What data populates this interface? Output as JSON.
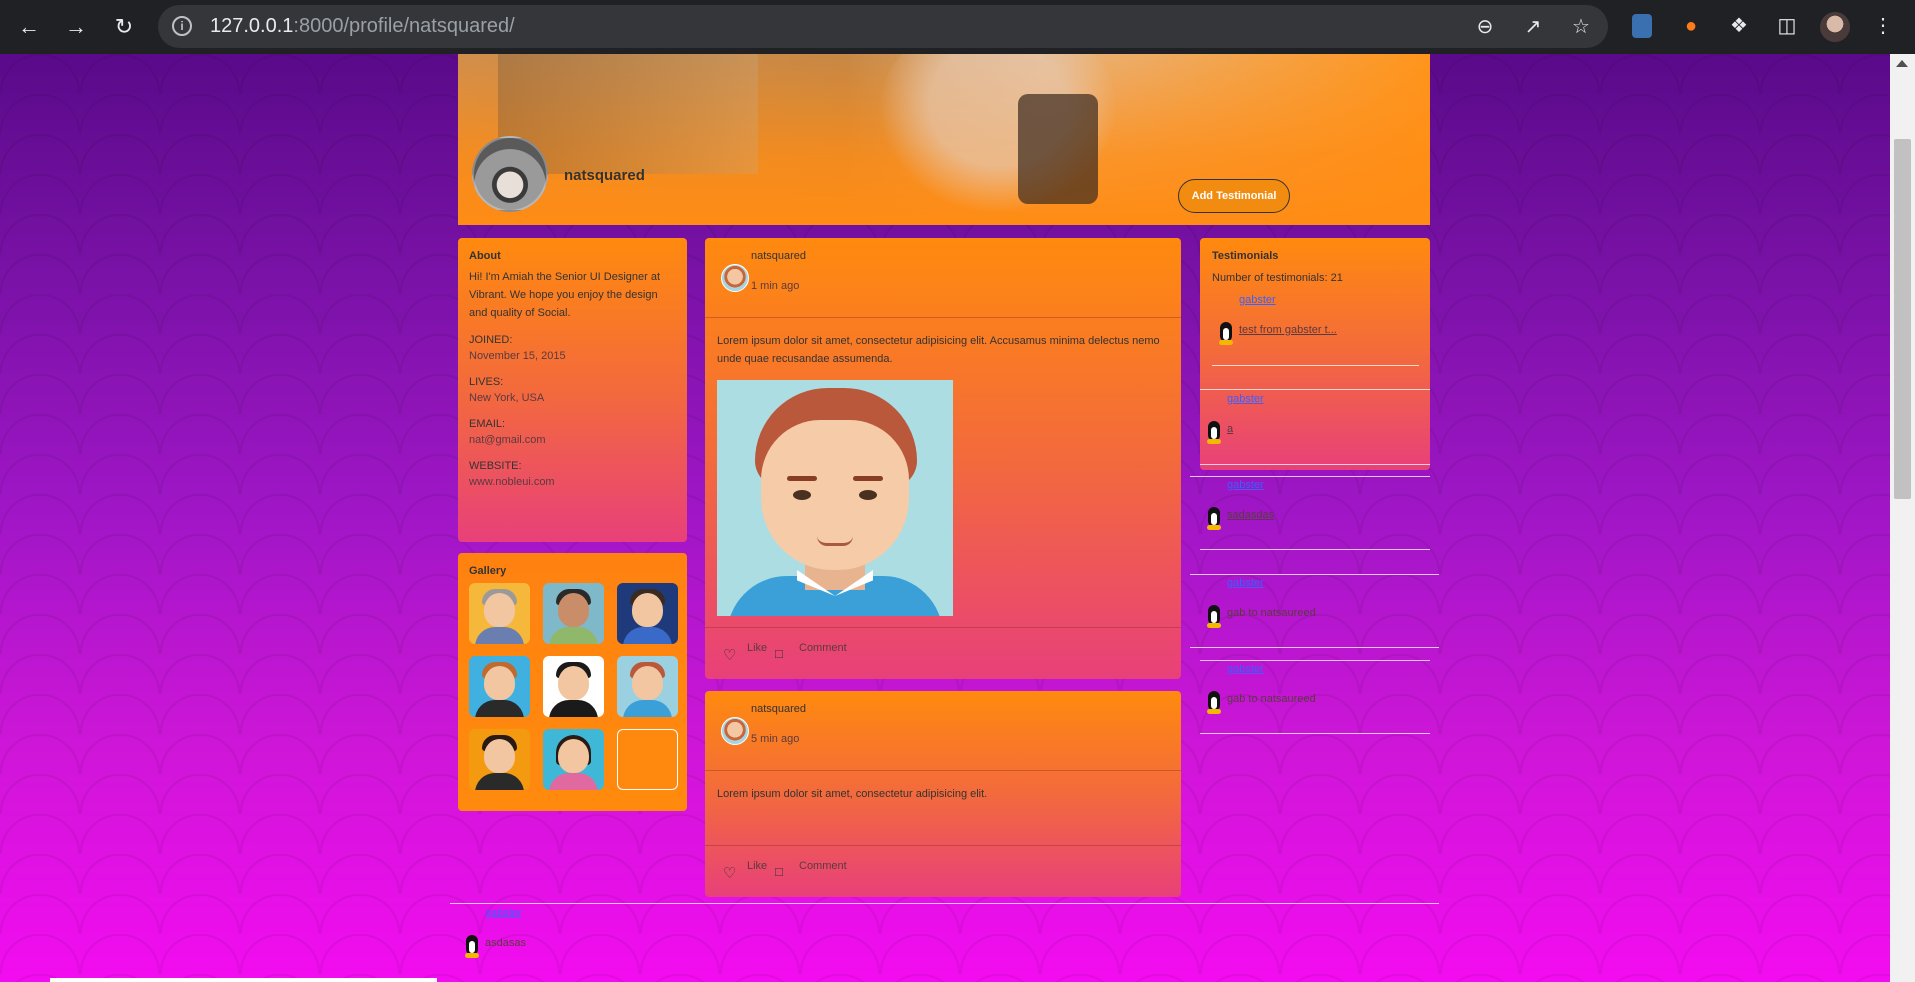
{
  "browser": {
    "url_host": "127.0.0.1",
    "url_path": ":8000/profile/natsquared/"
  },
  "profile": {
    "username": "natsquared",
    "add_testimonial_label": "Add Testimonial"
  },
  "about": {
    "title": "About",
    "bio": "Hi! I'm Amiah the Senior UI Designer at Vibrant. We hope you enjoy the design and quality of Social.",
    "fields": [
      {
        "label": "JOINED:",
        "value": "November 15, 2015"
      },
      {
        "label": "LIVES:",
        "value": "New York, USA"
      },
      {
        "label": "EMAIL:",
        "value": "nat@gmail.com"
      },
      {
        "label": "WEBSITE:",
        "value": "www.nobleui.com"
      }
    ]
  },
  "gallery": {
    "title": "Gallery"
  },
  "posts": [
    {
      "author": "natsquared",
      "time": "1 min ago",
      "text": "Lorem ipsum dolor sit amet, consectetur adipisicing elit. Accusamus minima delectus nemo unde quae recusandae assumenda.",
      "like_label": "Like",
      "comment_label": "Comment"
    },
    {
      "author": "natsquared",
      "time": "5 min ago",
      "text": "Lorem ipsum dolor sit amet, consectetur adipisicing elit.",
      "like_label": "Like",
      "comment_label": "Comment"
    }
  ],
  "testimonials": {
    "title": "Testimonials",
    "count_text": "Number of testimonials: 21",
    "items": [
      {
        "author": "gabster",
        "text": "test from gabster t..."
      },
      {
        "author": "gabster",
        "text": "a"
      },
      {
        "author": "gabster",
        "text": "sadasdas"
      },
      {
        "author": "gabster",
        "text": "gab to natsaureed"
      },
      {
        "author": "gabster",
        "text": "gab to natsaureed"
      },
      {
        "author": "gabster",
        "text": "asdasas"
      }
    ]
  }
}
